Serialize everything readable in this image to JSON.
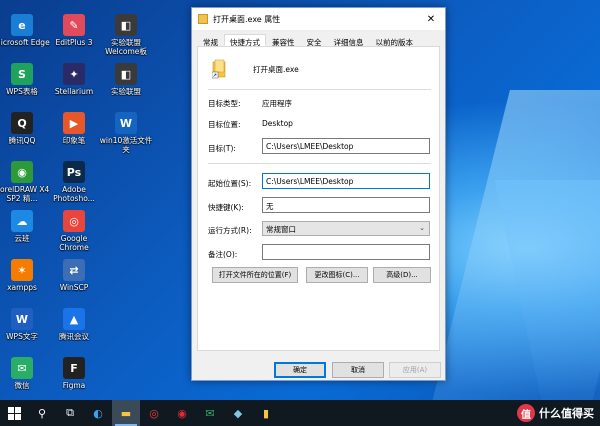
{
  "desktop_icons": [
    {
      "label": "Microsoft Edge",
      "glyph": "e",
      "color": "#1a7fd4",
      "icon": "edge-icon"
    },
    {
      "label": "EditPlus 3",
      "glyph": "✎",
      "color": "#e04a5a",
      "icon": "editplus-icon"
    },
    {
      "label": "实验联盟 Welcome板",
      "glyph": "◧",
      "color": "#3a3a3a",
      "icon": "app-icon"
    },
    {
      "label": "WPS表格",
      "glyph": "S",
      "color": "#1fa35c",
      "icon": "wps-sheet-icon"
    },
    {
      "label": "Stellarium",
      "glyph": "✦",
      "color": "#2a2a66",
      "icon": "stellarium-icon"
    },
    {
      "label": "实验联盟",
      "glyph": "◧",
      "color": "#3a3a3a",
      "icon": "app-icon"
    },
    {
      "label": "腾讯QQ",
      "glyph": "Q",
      "color": "#222",
      "icon": "qq-icon"
    },
    {
      "label": "印象笔",
      "glyph": "▶",
      "color": "#e8572a",
      "icon": "app-icon"
    },
    {
      "label": "win10激活文件夹",
      "glyph": "W",
      "color": "#1565c0",
      "icon": "shortcut-icon"
    },
    {
      "label": "CorelDRAW X4 SP2 精...",
      "glyph": "◉",
      "color": "#2d9a3a",
      "icon": "coreldraw-icon"
    },
    {
      "label": "Adobe Photosho...",
      "glyph": "Ps",
      "color": "#0b2a4a",
      "icon": "photoshop-icon"
    },
    {
      "label": "",
      "glyph": "",
      "color": "",
      "icon": ""
    },
    {
      "label": "云班",
      "glyph": "☁",
      "color": "#1e88e5",
      "icon": "app-icon"
    },
    {
      "label": "Google Chrome",
      "glyph": "◎",
      "color": "#e8453c",
      "icon": "chrome-icon"
    },
    {
      "label": "",
      "glyph": "",
      "color": "",
      "icon": ""
    },
    {
      "label": "xampps",
      "glyph": "✶",
      "color": "#f57c00",
      "icon": "xampp-icon"
    },
    {
      "label": "WinSCP",
      "glyph": "⇄",
      "color": "#3d6db5",
      "icon": "winscp-icon"
    },
    {
      "label": "",
      "glyph": "",
      "color": "",
      "icon": ""
    },
    {
      "label": "WPS文字",
      "glyph": "W",
      "color": "#1e5fc1",
      "icon": "wps-writer-icon"
    },
    {
      "label": "腾讯会议",
      "glyph": "▲",
      "color": "#1a73e8",
      "icon": "meeting-icon"
    },
    {
      "label": "",
      "glyph": "",
      "color": "",
      "icon": ""
    },
    {
      "label": "微信",
      "glyph": "✉",
      "color": "#2aae67",
      "icon": "wechat-icon"
    },
    {
      "label": "Figma",
      "glyph": "F",
      "color": "#222",
      "icon": "figma-icon"
    }
  ],
  "dialog": {
    "title": "打开桌面.exe 属性",
    "tabs": [
      "常规",
      "快捷方式",
      "兼容性",
      "安全",
      "详细信息",
      "以前的版本"
    ],
    "active_tab": "快捷方式",
    "file_name": "打开桌面.exe",
    "target_type_label": "目标类型:",
    "target_type_value": "应用程序",
    "target_location_label": "目标位置:",
    "target_location_value": "Desktop",
    "target_label": "目标(T):",
    "target_value": "C:\\Users\\LMEE\\Desktop",
    "start_in_label": "起始位置(S):",
    "start_in_value": "C:\\Users\\LMEE\\Desktop",
    "shortcut_key_label": "快捷键(K):",
    "shortcut_key_value": "无",
    "run_label": "运行方式(R):",
    "run_value": "常规窗口",
    "comment_label": "备注(O):",
    "comment_value": "",
    "open_location_button": "打开文件所在的位置(F)",
    "change_icon_button": "更改图标(C)...",
    "advanced_button": "高级(D)...",
    "ok_button": "确定",
    "cancel_button": "取消",
    "apply_button": "应用(A)"
  },
  "watermark": {
    "badge": "值",
    "text": "什么值得买"
  }
}
